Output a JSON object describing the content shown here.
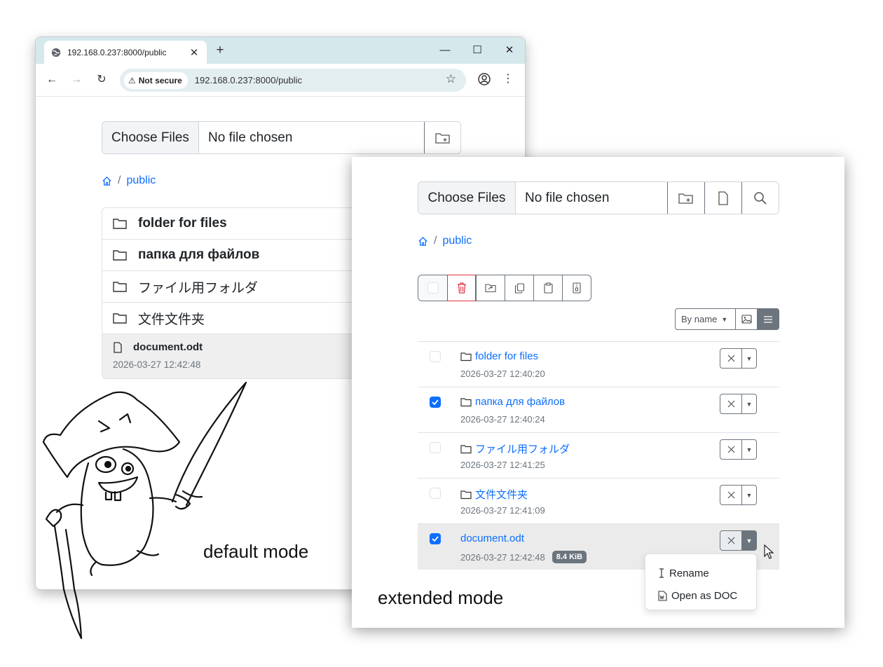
{
  "browser": {
    "tab_title": "192.168.0.237:8000/public",
    "security_label": "Not secure",
    "url": "192.168.0.237:8000/public"
  },
  "default_mode": {
    "choose_files": "Choose Files",
    "no_file": "No file chosen",
    "breadcrumb_current": "public",
    "folders": [
      "folder for files",
      "папка для файлов",
      "ファイル用フォルダ",
      "文件文件夹"
    ],
    "file": {
      "name": "document.odt",
      "date": "2026-03-27 12:42:48"
    },
    "caption": "default mode"
  },
  "extended_mode": {
    "choose_files": "Choose Files",
    "no_file": "No file chosen",
    "breadcrumb_current": "public",
    "sort_label": "By name",
    "items": [
      {
        "name": "folder for files",
        "date": "2026-03-27 12:40:20",
        "checked": false
      },
      {
        "name": "папка для файлов",
        "date": "2026-03-27 12:40:24",
        "checked": true
      },
      {
        "name": "ファイル用フォルダ",
        "date": "2026-03-27 12:41:25",
        "checked": false
      },
      {
        "name": "文件文件夹",
        "date": "2026-03-27 12:41:09",
        "checked": false
      },
      {
        "name": "document.odt",
        "date": "2026-03-27 12:42:48",
        "size": "8.4 KiB",
        "checked": true
      }
    ],
    "menu": {
      "rename": "Rename",
      "open_as_doc": "Open as DOC"
    },
    "caption": "extended mode"
  },
  "colors": {
    "link": "#0d6efd",
    "danger": "#dc3545",
    "secondary": "#6c757d",
    "tabbar": "#d5e8ec"
  }
}
